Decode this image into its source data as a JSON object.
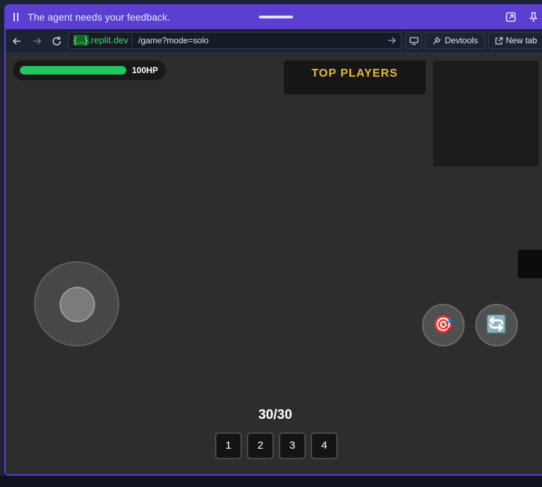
{
  "banner": {
    "message": "The agent needs your feedback."
  },
  "browser": {
    "url_host_brace": "{...}",
    "url_host_suffix": ".replit.dev",
    "url_path": "/game?mode=solo",
    "devtools_label": "Devtools",
    "new_tab_label": "New tab"
  },
  "game": {
    "health_percent": 100,
    "health_label": "100HP",
    "leaderboard_title": "TOP PLAYERS",
    "ammo": "30/30",
    "weapon_slots": [
      "1",
      "2",
      "3",
      "4"
    ],
    "fire_icon": "🎯",
    "reload_icon": "🔄"
  },
  "colors": {
    "frame_accent": "#5b3fd1",
    "health_green": "#22c55e",
    "leaderboard_gold": "#e9b930"
  }
}
